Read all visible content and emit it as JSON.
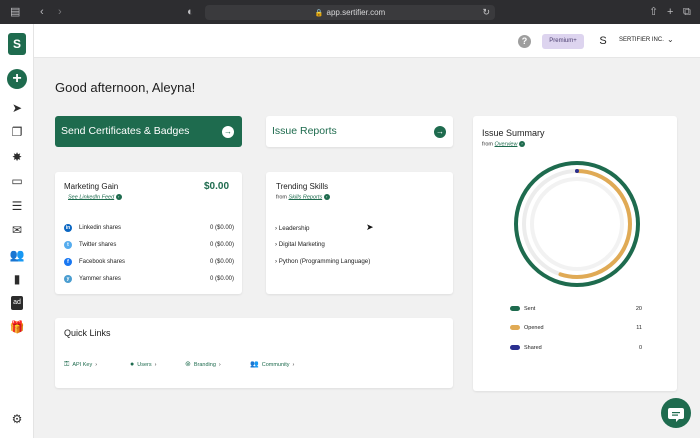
{
  "browser": {
    "url": "app.sertifier.com"
  },
  "topbar": {
    "help_icon": "?",
    "premium_label": "Premium+",
    "avatar_letter": "S",
    "org_name": "SERTIFIER INC.",
    "org_chevron": "⌄"
  },
  "sidebar": {
    "logo": "S",
    "add": "+",
    "settings_icon": "⚙"
  },
  "greeting": "Good afternoon, Aleyna!",
  "actions": {
    "send_label": "Send Certificates & Badges",
    "issue_reports_label": "Issue Reports"
  },
  "marketing": {
    "title": "Marketing Gain",
    "value": "$0.00",
    "link": "See LinkedIn Feed",
    "shares": [
      {
        "label": "Linkedin shares",
        "value": "0 ($0.00)",
        "icon": "in",
        "color": "#0a66c2"
      },
      {
        "label": "Twitter shares",
        "value": "0 ($0.00)",
        "icon": "t",
        "color": "#55acee"
      },
      {
        "label": "Facebook shares",
        "value": "0 ($0.00)",
        "icon": "f",
        "color": "#1877f2"
      },
      {
        "label": "Yammer shares",
        "value": "0 ($0.00)",
        "icon": "y",
        "color": "#4a9dd0"
      }
    ]
  },
  "skills": {
    "title": "Trending Skills",
    "from_label": "from",
    "link": "Skills Reports",
    "items": [
      "Leadership",
      "Digital Marketing",
      "Python (Programming Language)"
    ]
  },
  "quick_links": {
    "title": "Quick Links",
    "items": [
      {
        "label": "API Key",
        "icon": "key-icon"
      },
      {
        "label": "Users",
        "icon": "user-icon"
      },
      {
        "label": "Branding",
        "icon": "branding-icon"
      },
      {
        "label": "Community",
        "icon": "community-icon"
      }
    ]
  },
  "issue_summary": {
    "title": "Issue Summary",
    "from_label": "from",
    "link": "Overview",
    "legend": [
      {
        "label": "Sent",
        "value": 20,
        "color": "#1e6b4e"
      },
      {
        "label": "Opened",
        "value": 11,
        "color": "#e0aa55"
      },
      {
        "label": "Shared",
        "value": 0,
        "color": "#2a2f8f"
      }
    ]
  },
  "colors": {
    "brand": "#1e6b4e",
    "opened": "#e0aa55",
    "shared": "#2a2f8f"
  }
}
